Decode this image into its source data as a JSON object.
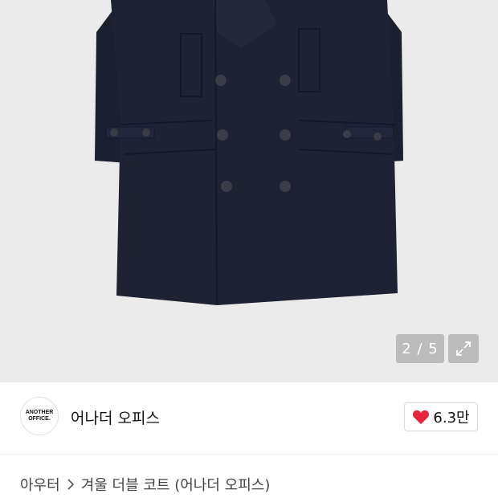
{
  "gallery": {
    "counter": "2 / 5",
    "expand_icon": "expand-icon"
  },
  "brand": {
    "logo_line1": "ANOTHER",
    "logo_line2": "OFFICE.",
    "name": "어나더 오피스",
    "like_icon": "heart-icon",
    "like_color": "#e8233b",
    "like_count": "6.3만"
  },
  "breadcrumb": {
    "category": "아우터",
    "separator_icon": "chevron-right-icon",
    "product": "겨울 더블 코트 (어나더 오피스)"
  }
}
